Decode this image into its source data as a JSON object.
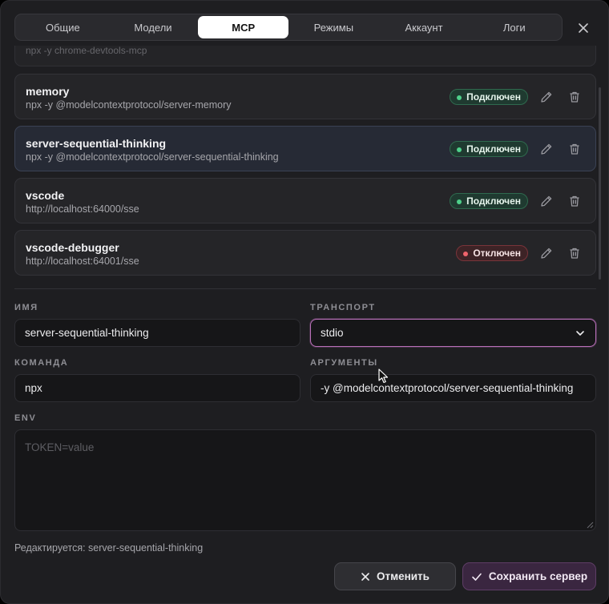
{
  "tabs": [
    {
      "label": "Общие",
      "active": false
    },
    {
      "label": "Модели",
      "active": false
    },
    {
      "label": "MCP",
      "active": true
    },
    {
      "label": "Режимы",
      "active": false
    },
    {
      "label": "Аккаунт",
      "active": false
    },
    {
      "label": "Логи",
      "active": false
    }
  ],
  "servers": {
    "partial_cmd": "npx -y chrome-devtools-mcp",
    "items": [
      {
        "name": "memory",
        "cmd": "npx -y @modelcontextprotocol/server-memory",
        "status": "Подключен",
        "state": "on"
      },
      {
        "name": "server-sequential-thinking",
        "cmd": "npx -y @modelcontextprotocol/server-sequential-thinking",
        "status": "Подключен",
        "state": "on"
      },
      {
        "name": "vscode",
        "cmd": "http://localhost:64000/sse",
        "status": "Подключен",
        "state": "on"
      },
      {
        "name": "vscode-debugger",
        "cmd": "http://localhost:64001/sse",
        "status": "Отключен",
        "state": "off"
      }
    ]
  },
  "form": {
    "name_label": "ИМЯ",
    "name_value": "server-sequential-thinking",
    "transport_label": "ТРАНСПОРТ",
    "transport_value": "stdio",
    "command_label": "КОМАНДА",
    "command_value": "npx",
    "args_label": "АРГУМЕНТЫ",
    "args_value": "-y @modelcontextprotocol/server-sequential-thinking",
    "env_label": "ENV",
    "env_placeholder": "TOKEN=value"
  },
  "status_text": "Редактируется: server-sequential-thinking",
  "buttons": {
    "cancel": "Отменить",
    "save": "Сохранить сервер"
  },
  "colors": {
    "accent": "#b86fb8",
    "connected": "#4ed08a",
    "disconnected": "#f0646c"
  }
}
